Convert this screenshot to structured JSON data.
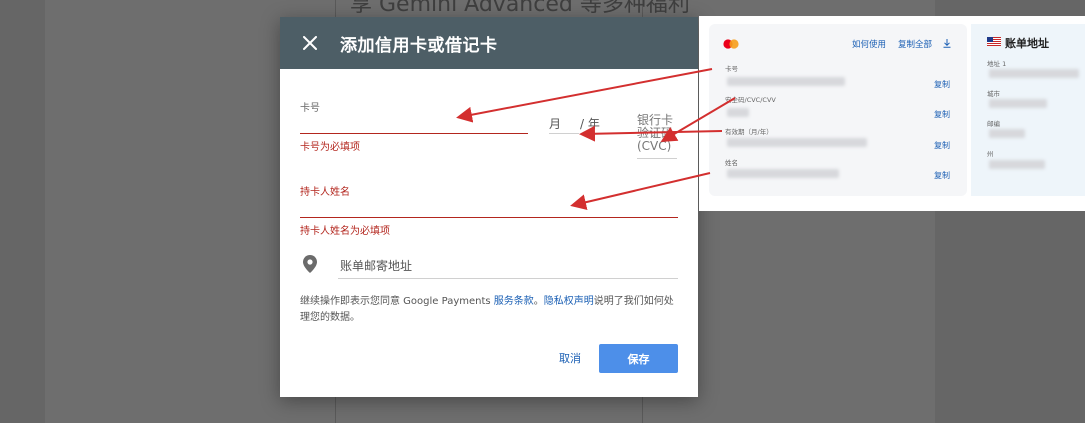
{
  "background": {
    "title": "享 Gemini Advanced 等多种福利"
  },
  "dialog": {
    "title": "添加信用卡或借记卡",
    "card_number_label": "卡号",
    "card_number_error": "卡号为必填项",
    "month_placeholder": "月",
    "year_placeholder": "/ 年",
    "cvc_label": "银行卡验证码 (CVC)",
    "holder_label": "持卡人姓名",
    "holder_error": "持卡人姓名为必填项",
    "address_placeholder": "账单邮寄地址",
    "terms_prefix": "继续操作即表示您同意 Google Payments ",
    "terms_link": "服务条款",
    "terms_sep": "。",
    "privacy_link": "隐私权声明",
    "terms_suffix": "说明了我们如何处理您的数据。",
    "cancel_label": "取消",
    "save_label": "保存"
  },
  "autofill": {
    "how_to_use": "如何使用",
    "copy_all": "复制全部",
    "card_fields": [
      {
        "label": "卡号",
        "copy": "复制"
      },
      {
        "label": "安全码/CVC/CVV",
        "copy": "复制"
      },
      {
        "label": "有效期（月/年）",
        "copy": "复制"
      },
      {
        "label": "姓名",
        "copy": "复制"
      }
    ],
    "billing_title": "账单地址",
    "billing_fields": [
      {
        "label": "地址 1"
      },
      {
        "label": "城市"
      },
      {
        "label": "邮编"
      },
      {
        "label": "州"
      }
    ]
  },
  "colors": {
    "header": "#4d5e66",
    "error": "#b3261e",
    "accent": "#4d8fe9",
    "link": "#1a5fb4"
  }
}
